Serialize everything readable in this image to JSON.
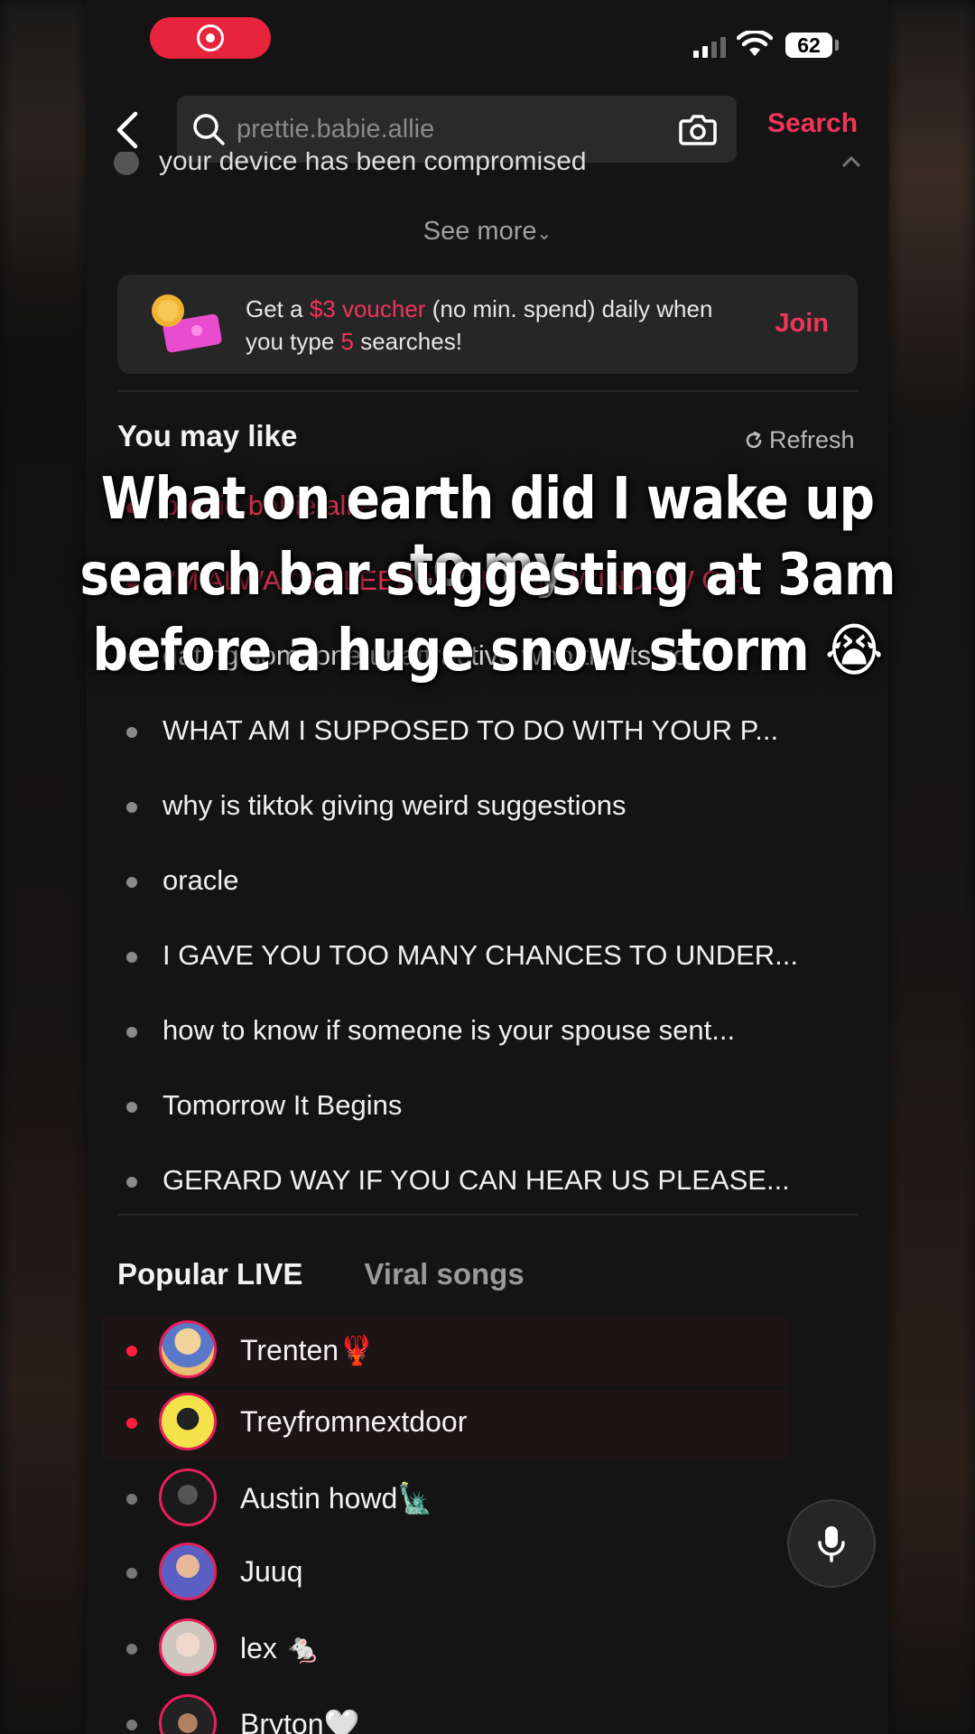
{
  "status_bar": {
    "battery": "62"
  },
  "header": {
    "search_placeholder": "prettie.babie.allie",
    "search_button": "Search"
  },
  "history": {
    "cut_item": "your device has been compromised",
    "see_more": "See more"
  },
  "promo": {
    "text_1": "Get a ",
    "voucher": "$3 voucher",
    "text_2": " (no min. spend) daily when you type ",
    "count": "5",
    "text_3": " searches!",
    "join": "Join"
  },
  "you_may_like": {
    "title": "You may like",
    "refresh": "Refresh",
    "items": [
      {
        "label": "prettie.babie.allie",
        "highlight": true
      },
      {
        "label": "I'M ALWAYS SLEEPING IN THE WINDOW OF...",
        "highlight": true
      },
      {
        "label": "dating someone unattractive who treats yo...",
        "highlight": false
      },
      {
        "label": "WHAT AM I SUPPOSED TO DO WITH YOUR P...",
        "highlight": false
      },
      {
        "label": "why is tiktok giving weird suggestions",
        "highlight": false
      },
      {
        "label": "oracle",
        "highlight": false
      },
      {
        "label": "I GAVE YOU TOO MANY CHANCES TO UNDER...",
        "highlight": false
      },
      {
        "label": "how to know if someone is your spouse sent...",
        "highlight": false
      },
      {
        "label": "Tomorrow It Begins",
        "highlight": false
      },
      {
        "label": "GERARD WAY IF YOU CAN HEAR US PLEASE...",
        "highlight": false
      }
    ]
  },
  "tabs": {
    "popular_live": "Popular LIVE",
    "viral_songs": "Viral songs"
  },
  "live": [
    {
      "name": "Trenten🦞",
      "live": true
    },
    {
      "name": "Treyfromnextdoor",
      "live": true
    },
    {
      "name": "Austin howd🗽",
      "live": false
    },
    {
      "name": "Juuq",
      "live": false
    },
    {
      "name": "lex 🐁",
      "live": false
    },
    {
      "name": "Bryton🤍",
      "live": false
    }
  ],
  "overlay_caption": {
    "line_1": "What on earth did I wake up to my",
    "line_2": "search bar suggesting at 3am",
    "line_3": "before a huge snow storm 😭"
  },
  "colors": {
    "accent": "#f0355a",
    "live_dot": "#ff1f3d",
    "background": "#141414"
  }
}
